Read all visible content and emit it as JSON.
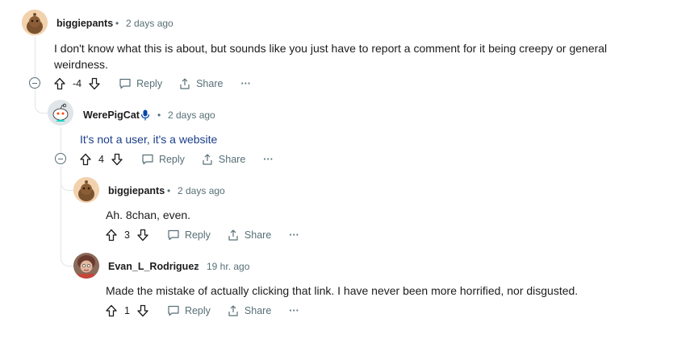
{
  "comments": [
    {
      "username": "biggiepants",
      "time": "2 days ago",
      "body": "I don't know what this is about, but sounds like you just have to report a comment for it being creepy or general weirdness.",
      "score": "-4",
      "reply_label": "Reply",
      "share_label": "Share",
      "more_label": "···"
    },
    {
      "username": "WerePigCat",
      "time": "2 days ago",
      "body": "It's not a user, it's a website",
      "score": "4",
      "reply_label": "Reply",
      "share_label": "Share",
      "more_label": "···"
    },
    {
      "username": "biggiepants",
      "time": "2 days ago",
      "body": "Ah. 8chan, even.",
      "score": "3",
      "reply_label": "Reply",
      "share_label": "Share",
      "more_label": "···"
    },
    {
      "username": "Evan_L_Rodriguez",
      "time": "19 hr. ago",
      "body": "Made the mistake of actually clicking that link. I have never been more horrified, nor disgusted.",
      "score": "1",
      "reply_label": "Reply",
      "share_label": "Share",
      "more_label": "···"
    }
  ],
  "separator": "•",
  "colors": {
    "text": "#1c1c1c",
    "meta": "#576f76",
    "thread": "#e1e5e8",
    "link_blue": "#1a3f8a",
    "mic_blue": "#0045ac"
  }
}
